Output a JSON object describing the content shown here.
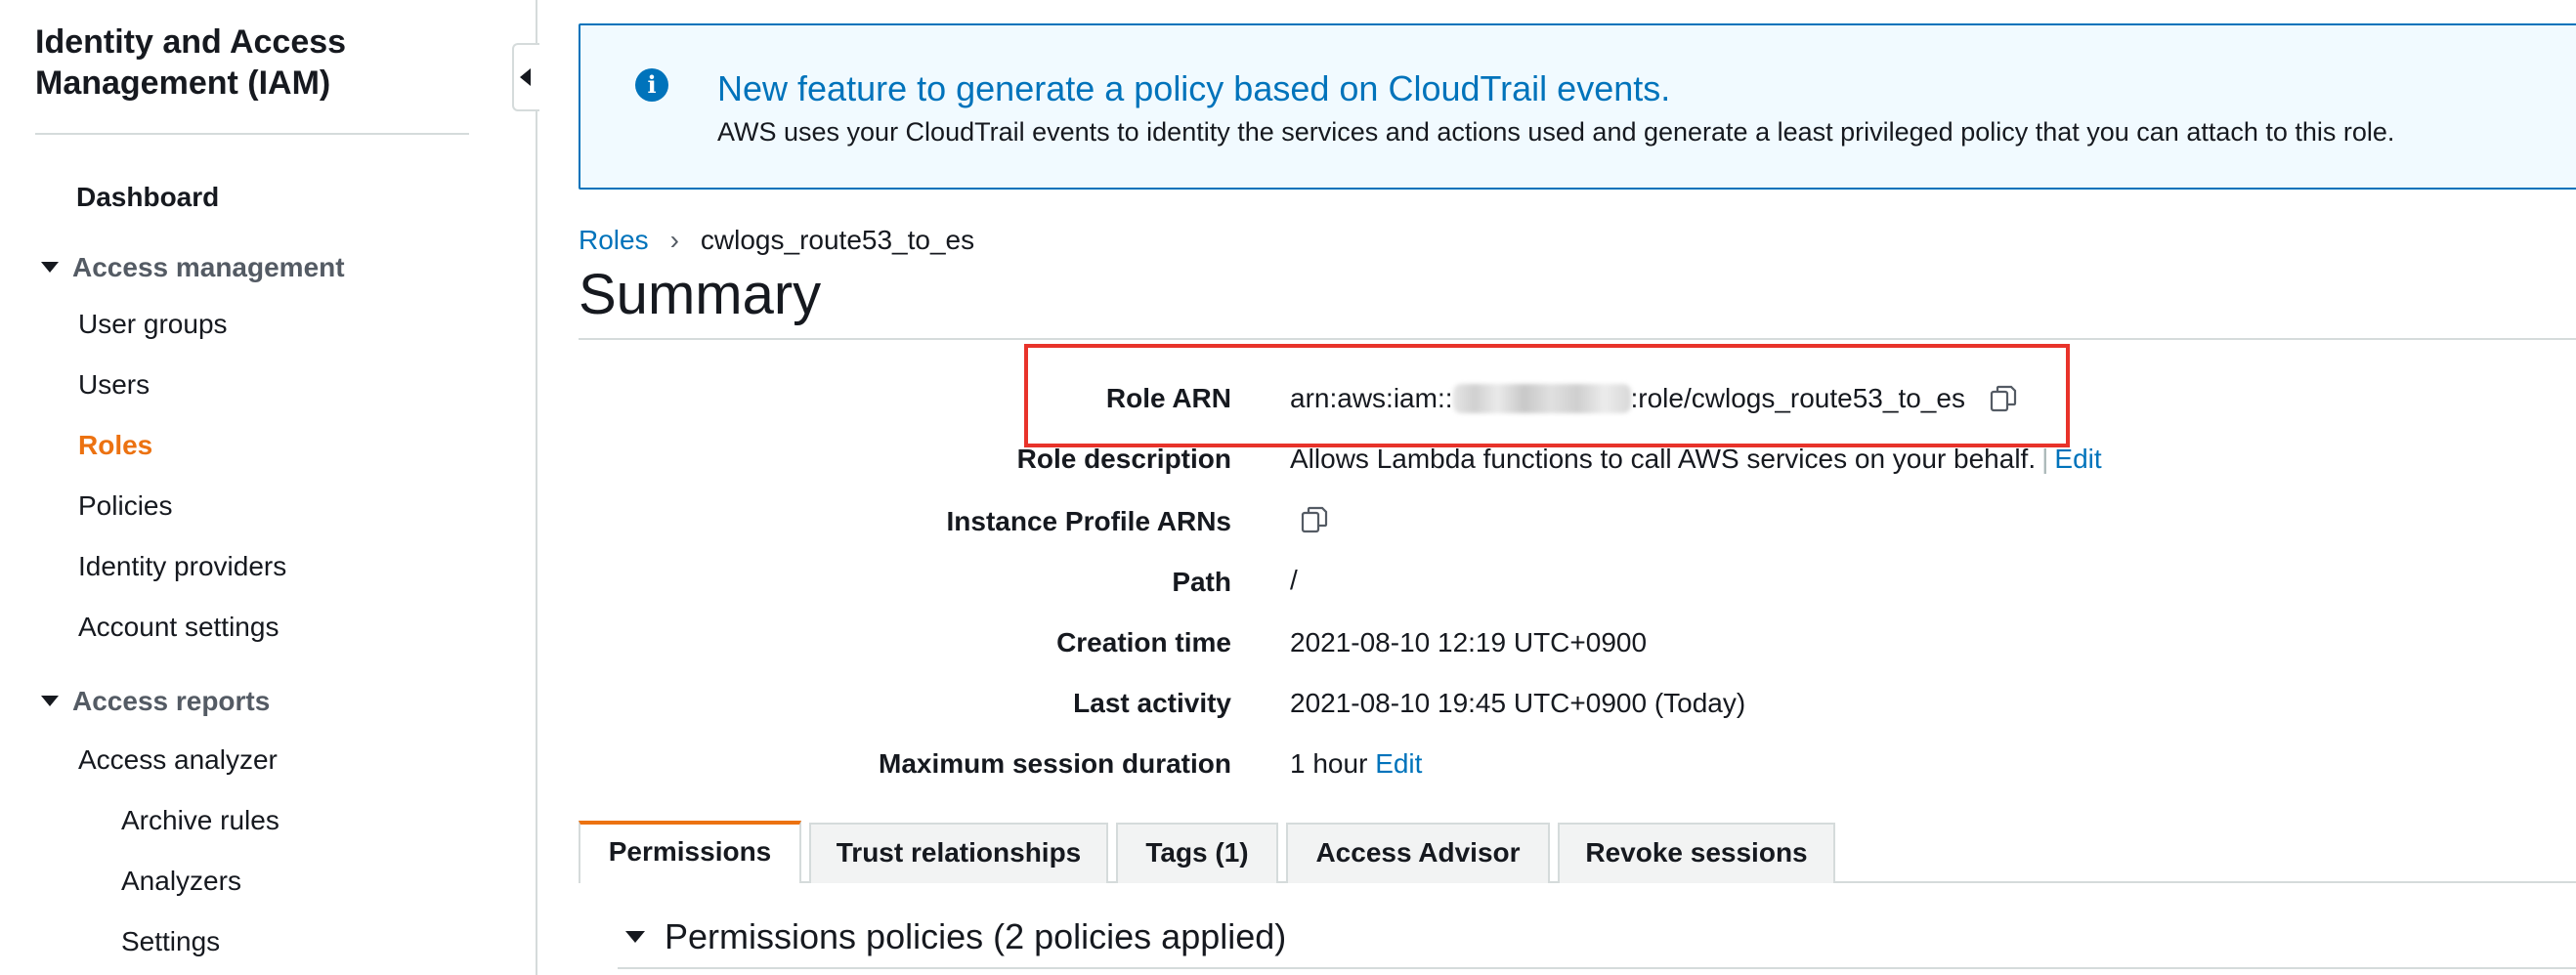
{
  "sidebar": {
    "title": "Identity and Access Management (IAM)",
    "dashboard": "Dashboard",
    "access_management": "Access management",
    "items": [
      "User groups",
      "Users",
      "Roles",
      "Policies",
      "Identity providers",
      "Account settings"
    ],
    "access_reports": "Access reports",
    "analyzer": "Access analyzer",
    "analyzer_children": [
      "Archive rules",
      "Analyzers",
      "Settings"
    ]
  },
  "banner": {
    "title": "New feature to generate a policy based on CloudTrail events.",
    "text": "AWS uses your CloudTrail events to identity the services and actions used and generate a least privileged policy that you can attach to this role."
  },
  "breadcrumb": {
    "parent": "Roles",
    "separator": "›",
    "current": "cwlogs_route53_to_es"
  },
  "page_title": "Summary",
  "summary": {
    "role_arn_label": "Role ARN",
    "role_arn_prefix": "arn:aws:iam::",
    "role_arn_suffix": ":role/cwlogs_route53_to_es",
    "role_description_label": "Role description",
    "role_description": "Allows Lambda functions to call AWS services on your behalf.",
    "edit": "Edit",
    "instance_profile_label": "Instance Profile ARNs",
    "path_label": "Path",
    "path": "/",
    "creation_time_label": "Creation time",
    "creation_time": "2021-08-10 12:19 UTC+0900",
    "last_activity_label": "Last activity",
    "last_activity": "2021-08-10 19:45 UTC+0900 (Today)",
    "max_session_label": "Maximum session duration",
    "max_session": "1 hour"
  },
  "tabs": [
    "Permissions",
    "Trust relationships",
    "Tags (1)",
    "Access Advisor",
    "Revoke sessions"
  ],
  "permissions_heading": "Permissions policies (2 policies applied)",
  "colors": {
    "link": "#0073bb",
    "active_nav": "#ec7211",
    "highlight": "#e8332a",
    "banner_bg": "#f1faff"
  },
  "icons": {
    "info": "info-icon",
    "copy": "copy-icon",
    "caret": "caret-down-icon",
    "collapse": "chevron-left-icon"
  }
}
